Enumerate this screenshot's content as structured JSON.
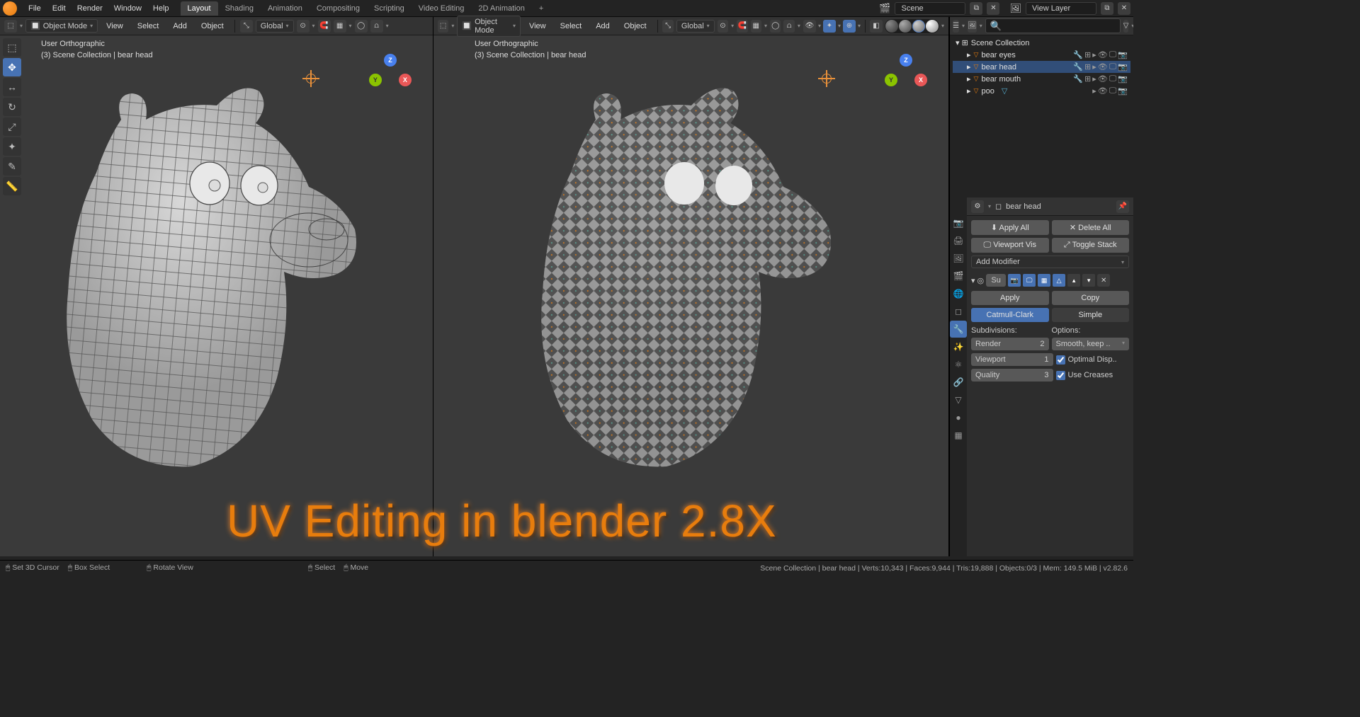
{
  "topmenu": {
    "file": "File",
    "edit": "Edit",
    "render": "Render",
    "window": "Window",
    "help": "Help"
  },
  "workspaces": {
    "layout": "Layout",
    "shading": "Shading",
    "animation": "Animation",
    "compositing": "Compositing",
    "scripting": "Scripting",
    "video": "Video Editing",
    "anim2d": "2D Animation"
  },
  "scene": {
    "label": "Scene",
    "viewlayer": "View Layer"
  },
  "vp": {
    "mode": "Object Mode",
    "view": "View",
    "select": "Select",
    "add": "Add",
    "object": "Object",
    "global": "Global"
  },
  "overlay": {
    "view": "User Orthographic",
    "collection": "(3) Scene Collection | bear head"
  },
  "outliner": {
    "root": "Scene Collection",
    "items": [
      "bear eyes",
      "bear head",
      "bear mouth",
      "poo"
    ]
  },
  "props": {
    "objname": "bear head",
    "applyall": "Apply All",
    "deleteall": "Delete All",
    "viewportvis": "Viewport Vis",
    "togglestack": "Toggle Stack",
    "addmod": "Add Modifier",
    "su": "Su",
    "apply": "Apply",
    "copy": "Copy",
    "catmull": "Catmull-Clark",
    "simple": "Simple",
    "subdivisions": "Subdivisions:",
    "options": "Options:",
    "render": "Render",
    "render_v": "2",
    "viewport": "Viewport",
    "viewport_v": "1",
    "quality": "Quality",
    "quality_v": "3",
    "smooth": "Smooth, keep ..",
    "optimal": "Optimal Disp..",
    "creases": "Use Creases"
  },
  "status": {
    "cursor": "Set 3D Cursor",
    "box": "Box Select",
    "rotate": "Rotate View",
    "select": "Select",
    "move": "Move",
    "right": "Scene Collection | bear head | Verts:10,343 | Faces:9,944 | Tris:19,888 | Objects:0/3 | Mem: 149.5 MiB | v2.82.6"
  },
  "title": "UV Editing in blender 2.8X"
}
